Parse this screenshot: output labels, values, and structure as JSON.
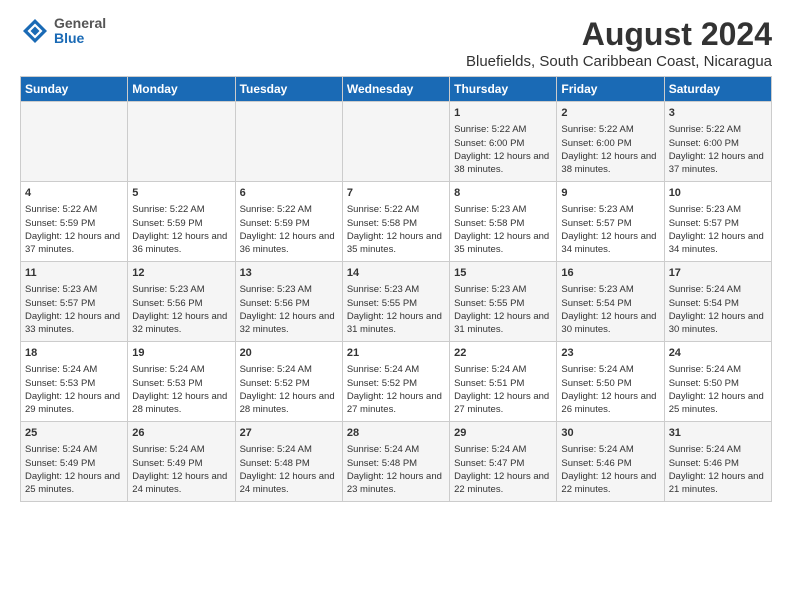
{
  "header": {
    "logo_general": "General",
    "logo_blue": "Blue",
    "main_title": "August 2024",
    "subtitle": "Bluefields, South Caribbean Coast, Nicaragua"
  },
  "weekdays": [
    "Sunday",
    "Monday",
    "Tuesday",
    "Wednesday",
    "Thursday",
    "Friday",
    "Saturday"
  ],
  "weeks": [
    [
      {
        "day": "",
        "sunrise": "",
        "sunset": "",
        "daylight": ""
      },
      {
        "day": "",
        "sunrise": "",
        "sunset": "",
        "daylight": ""
      },
      {
        "day": "",
        "sunrise": "",
        "sunset": "",
        "daylight": ""
      },
      {
        "day": "",
        "sunrise": "",
        "sunset": "",
        "daylight": ""
      },
      {
        "day": "1",
        "sunrise": "Sunrise: 5:22 AM",
        "sunset": "Sunset: 6:00 PM",
        "daylight": "Daylight: 12 hours and 38 minutes."
      },
      {
        "day": "2",
        "sunrise": "Sunrise: 5:22 AM",
        "sunset": "Sunset: 6:00 PM",
        "daylight": "Daylight: 12 hours and 38 minutes."
      },
      {
        "day": "3",
        "sunrise": "Sunrise: 5:22 AM",
        "sunset": "Sunset: 6:00 PM",
        "daylight": "Daylight: 12 hours and 37 minutes."
      }
    ],
    [
      {
        "day": "4",
        "sunrise": "Sunrise: 5:22 AM",
        "sunset": "Sunset: 5:59 PM",
        "daylight": "Daylight: 12 hours and 37 minutes."
      },
      {
        "day": "5",
        "sunrise": "Sunrise: 5:22 AM",
        "sunset": "Sunset: 5:59 PM",
        "daylight": "Daylight: 12 hours and 36 minutes."
      },
      {
        "day": "6",
        "sunrise": "Sunrise: 5:22 AM",
        "sunset": "Sunset: 5:59 PM",
        "daylight": "Daylight: 12 hours and 36 minutes."
      },
      {
        "day": "7",
        "sunrise": "Sunrise: 5:22 AM",
        "sunset": "Sunset: 5:58 PM",
        "daylight": "Daylight: 12 hours and 35 minutes."
      },
      {
        "day": "8",
        "sunrise": "Sunrise: 5:23 AM",
        "sunset": "Sunset: 5:58 PM",
        "daylight": "Daylight: 12 hours and 35 minutes."
      },
      {
        "day": "9",
        "sunrise": "Sunrise: 5:23 AM",
        "sunset": "Sunset: 5:57 PM",
        "daylight": "Daylight: 12 hours and 34 minutes."
      },
      {
        "day": "10",
        "sunrise": "Sunrise: 5:23 AM",
        "sunset": "Sunset: 5:57 PM",
        "daylight": "Daylight: 12 hours and 34 minutes."
      }
    ],
    [
      {
        "day": "11",
        "sunrise": "Sunrise: 5:23 AM",
        "sunset": "Sunset: 5:57 PM",
        "daylight": "Daylight: 12 hours and 33 minutes."
      },
      {
        "day": "12",
        "sunrise": "Sunrise: 5:23 AM",
        "sunset": "Sunset: 5:56 PM",
        "daylight": "Daylight: 12 hours and 32 minutes."
      },
      {
        "day": "13",
        "sunrise": "Sunrise: 5:23 AM",
        "sunset": "Sunset: 5:56 PM",
        "daylight": "Daylight: 12 hours and 32 minutes."
      },
      {
        "day": "14",
        "sunrise": "Sunrise: 5:23 AM",
        "sunset": "Sunset: 5:55 PM",
        "daylight": "Daylight: 12 hours and 31 minutes."
      },
      {
        "day": "15",
        "sunrise": "Sunrise: 5:23 AM",
        "sunset": "Sunset: 5:55 PM",
        "daylight": "Daylight: 12 hours and 31 minutes."
      },
      {
        "day": "16",
        "sunrise": "Sunrise: 5:23 AM",
        "sunset": "Sunset: 5:54 PM",
        "daylight": "Daylight: 12 hours and 30 minutes."
      },
      {
        "day": "17",
        "sunrise": "Sunrise: 5:24 AM",
        "sunset": "Sunset: 5:54 PM",
        "daylight": "Daylight: 12 hours and 30 minutes."
      }
    ],
    [
      {
        "day": "18",
        "sunrise": "Sunrise: 5:24 AM",
        "sunset": "Sunset: 5:53 PM",
        "daylight": "Daylight: 12 hours and 29 minutes."
      },
      {
        "day": "19",
        "sunrise": "Sunrise: 5:24 AM",
        "sunset": "Sunset: 5:53 PM",
        "daylight": "Daylight: 12 hours and 28 minutes."
      },
      {
        "day": "20",
        "sunrise": "Sunrise: 5:24 AM",
        "sunset": "Sunset: 5:52 PM",
        "daylight": "Daylight: 12 hours and 28 minutes."
      },
      {
        "day": "21",
        "sunrise": "Sunrise: 5:24 AM",
        "sunset": "Sunset: 5:52 PM",
        "daylight": "Daylight: 12 hours and 27 minutes."
      },
      {
        "day": "22",
        "sunrise": "Sunrise: 5:24 AM",
        "sunset": "Sunset: 5:51 PM",
        "daylight": "Daylight: 12 hours and 27 minutes."
      },
      {
        "day": "23",
        "sunrise": "Sunrise: 5:24 AM",
        "sunset": "Sunset: 5:50 PM",
        "daylight": "Daylight: 12 hours and 26 minutes."
      },
      {
        "day": "24",
        "sunrise": "Sunrise: 5:24 AM",
        "sunset": "Sunset: 5:50 PM",
        "daylight": "Daylight: 12 hours and 25 minutes."
      }
    ],
    [
      {
        "day": "25",
        "sunrise": "Sunrise: 5:24 AM",
        "sunset": "Sunset: 5:49 PM",
        "daylight": "Daylight: 12 hours and 25 minutes."
      },
      {
        "day": "26",
        "sunrise": "Sunrise: 5:24 AM",
        "sunset": "Sunset: 5:49 PM",
        "daylight": "Daylight: 12 hours and 24 minutes."
      },
      {
        "day": "27",
        "sunrise": "Sunrise: 5:24 AM",
        "sunset": "Sunset: 5:48 PM",
        "daylight": "Daylight: 12 hours and 24 minutes."
      },
      {
        "day": "28",
        "sunrise": "Sunrise: 5:24 AM",
        "sunset": "Sunset: 5:48 PM",
        "daylight": "Daylight: 12 hours and 23 minutes."
      },
      {
        "day": "29",
        "sunrise": "Sunrise: 5:24 AM",
        "sunset": "Sunset: 5:47 PM",
        "daylight": "Daylight: 12 hours and 22 minutes."
      },
      {
        "day": "30",
        "sunrise": "Sunrise: 5:24 AM",
        "sunset": "Sunset: 5:46 PM",
        "daylight": "Daylight: 12 hours and 22 minutes."
      },
      {
        "day": "31",
        "sunrise": "Sunrise: 5:24 AM",
        "sunset": "Sunset: 5:46 PM",
        "daylight": "Daylight: 12 hours and 21 minutes."
      }
    ]
  ]
}
